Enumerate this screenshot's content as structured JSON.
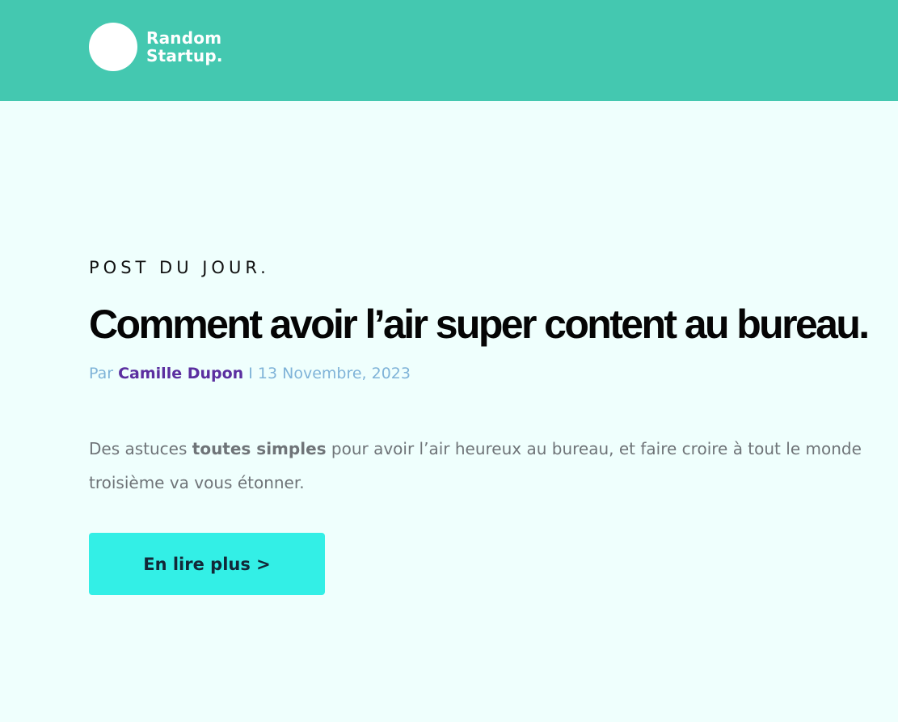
{
  "header": {
    "logo": {
      "line1": "Random",
      "line2": "Startup.",
      "icon": "white-circle-logo"
    }
  },
  "post": {
    "kicker": "POST DU JOUR.",
    "title": "Comment avoir l’air super content au bureau.",
    "meta": {
      "prefix": "Par",
      "author": "Camille Dupon",
      "separator": "I",
      "date": "13 Novembre, 2023"
    },
    "excerpt": {
      "before_bold": "Des astuces ",
      "bold": "toutes simples",
      "after_bold": " pour avoir l’air heureux au bureau, et faire croire à tout le monde",
      "line2": "troisième va vous étonner."
    },
    "cta_label": "En lire plus >"
  },
  "colors": {
    "header_bg": "#44c8b0",
    "page_bg": "#effffd",
    "cta_bg": "#33efe6",
    "author": "#5b2fa0",
    "meta": "#7fb3d8"
  }
}
